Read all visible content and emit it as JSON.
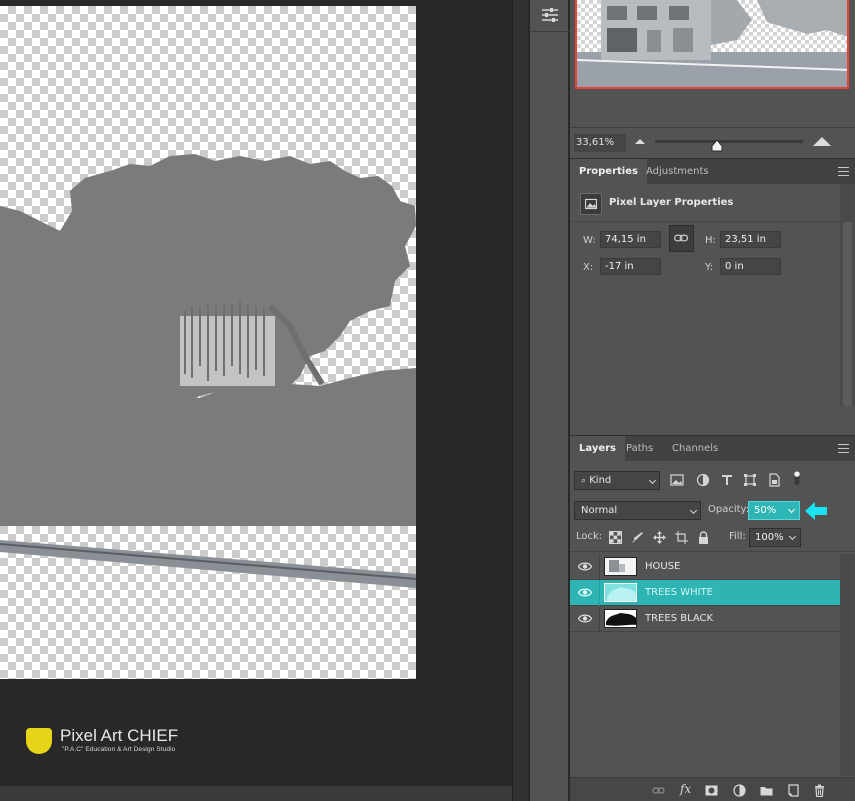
{
  "navigator": {
    "zoom": "33,61%"
  },
  "properties_panel": {
    "tabs": [
      {
        "label": "Properties",
        "active": true
      },
      {
        "label": "Adjustments",
        "active": false
      }
    ],
    "header": "Pixel Layer Properties",
    "w_label": "W:",
    "w_value": "74,15 in",
    "h_label": "H:",
    "h_value": "23,51 in",
    "x_label": "X:",
    "x_value": "-17 in",
    "y_label": "Y:",
    "y_value": "0 in"
  },
  "layers_panel": {
    "tabs": [
      {
        "label": "Layers",
        "active": true
      },
      {
        "label": "Paths",
        "active": false
      },
      {
        "label": "Channels",
        "active": false
      }
    ],
    "filter_kind": "Kind",
    "blend_mode": "Normal",
    "opacity_label": "Opacity:",
    "opacity_value": "50%",
    "lock_label": "Lock:",
    "fill_label": "Fill:",
    "fill_value": "100%",
    "layers": [
      {
        "name": "HOUSE",
        "visible": true,
        "selected": false
      },
      {
        "name": "TREES WHITE",
        "visible": true,
        "selected": true
      },
      {
        "name": "TREES BLACK",
        "visible": true,
        "selected": false
      }
    ],
    "footer_fx": "fx"
  },
  "logo": {
    "title": "Pixel Art CHIEF",
    "subtitle": "\"P.A.C\" Education & Art Design Studio"
  },
  "colors": {
    "selection_teal": "#2fb4b4",
    "annotation_arrow": "#19e3f0",
    "navigator_border": "#e8403b",
    "canvas_tree_gray": "#7a7a7a"
  },
  "icons": {
    "tool_strip": "adjustments-sliders-icon",
    "layer_visibility": "eye-icon",
    "filter_icons": [
      "image-filter-icon",
      "adjustment-filter-icon",
      "type-filter-icon",
      "shape-filter-icon",
      "smart-object-filter-icon",
      "filter-toggle-icon"
    ],
    "lock_icons": [
      "lock-transparent-icon",
      "lock-image-icon",
      "lock-position-icon",
      "lock-artboard-icon",
      "lock-all-icon"
    ],
    "footer_icons": [
      "link-layers-icon",
      "add-mask-icon",
      "new-fill-layer-icon",
      "new-group-icon",
      "new-layer-icon",
      "delete-layer-icon"
    ]
  }
}
